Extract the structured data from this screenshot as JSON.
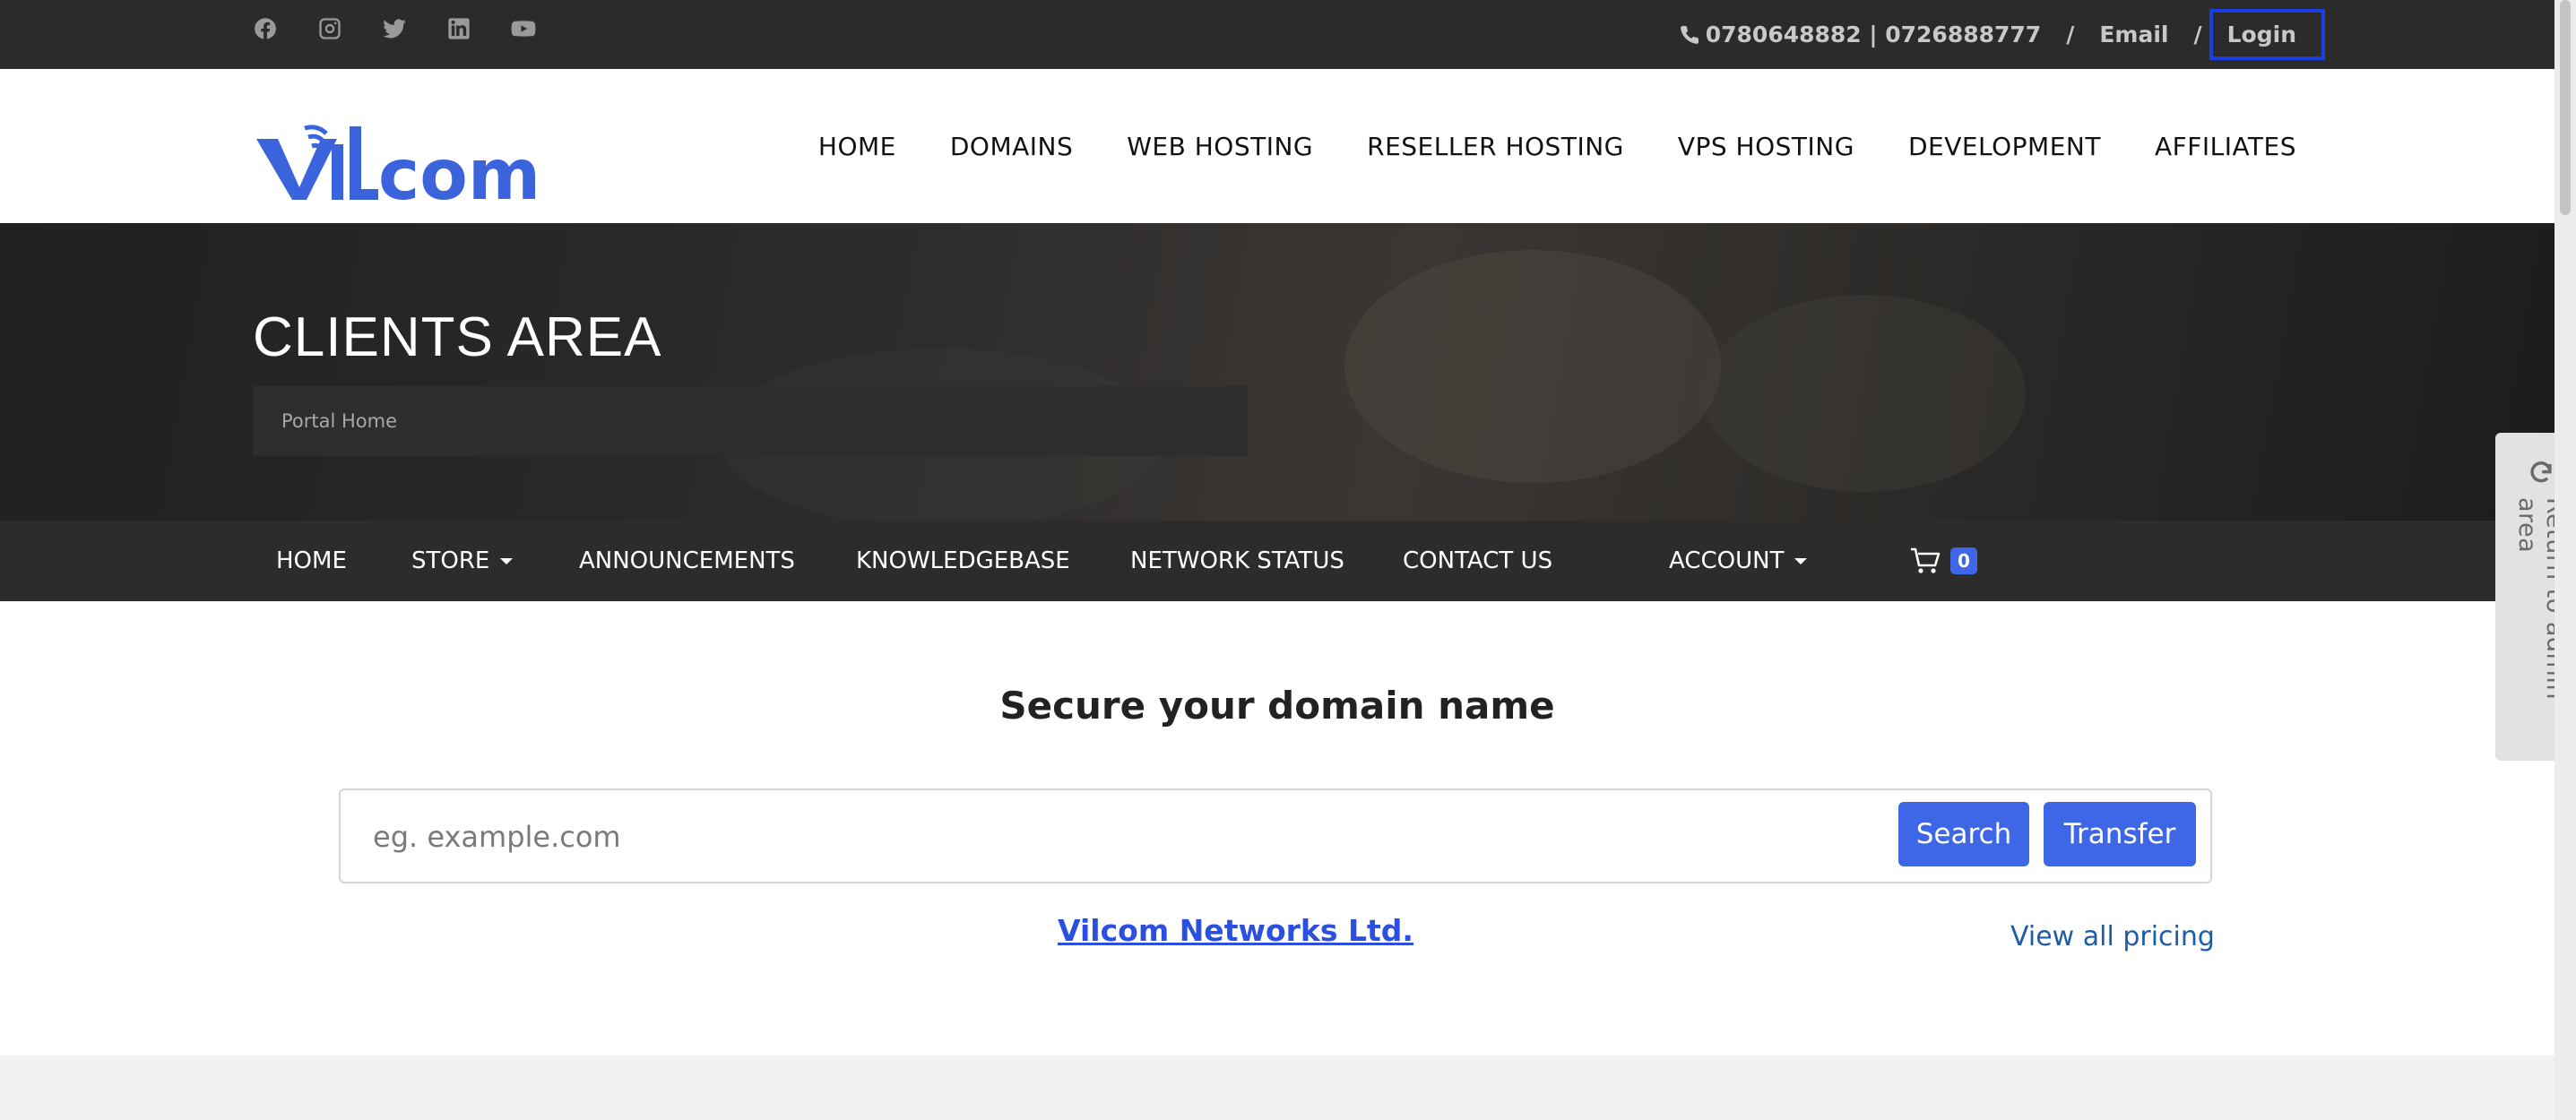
{
  "topbar": {
    "social_icons": [
      "facebook-icon",
      "instagram-icon",
      "twitter-icon",
      "linkedin-icon",
      "youtube-icon"
    ],
    "phone": "0780648882 | 0726888777",
    "sep1": "/",
    "email_label": "Email",
    "sep2": "/",
    "login_label": "Login"
  },
  "header": {
    "logo_text": "ViLcom",
    "nav": [
      "HOME",
      "DOMAINS",
      "WEB HOSTING",
      "RESELLER HOSTING",
      "VPS HOSTING",
      "DEVELOPMENT",
      "AFFILIATES"
    ]
  },
  "hero": {
    "title": "CLIENTS AREA",
    "breadcrumb": "Portal Home"
  },
  "subnav": {
    "home": "HOME",
    "store": "STORE",
    "announcements": "ANNOUNCEMENTS",
    "knowledgebase": "KNOWLEDGEBASE",
    "network_status": "NETWORK STATUS",
    "contact_us": "CONTACT US",
    "account": "ACCOUNT",
    "cart_count": "0"
  },
  "main": {
    "title": "Secure your domain name",
    "search_placeholder": "eg. example.com",
    "search_button": "Search",
    "transfer_button": "Transfer",
    "company_link": "Vilcom Networks Ltd.",
    "pricing_link": "View all pricing"
  },
  "admin_tab": {
    "label": "Return to admin area"
  },
  "colors": {
    "accent": "#3e67e8",
    "topbar_bg": "#2b2b2b",
    "subnav_bg": "#2c2c2c",
    "logo_blue": "#3b63dc"
  }
}
